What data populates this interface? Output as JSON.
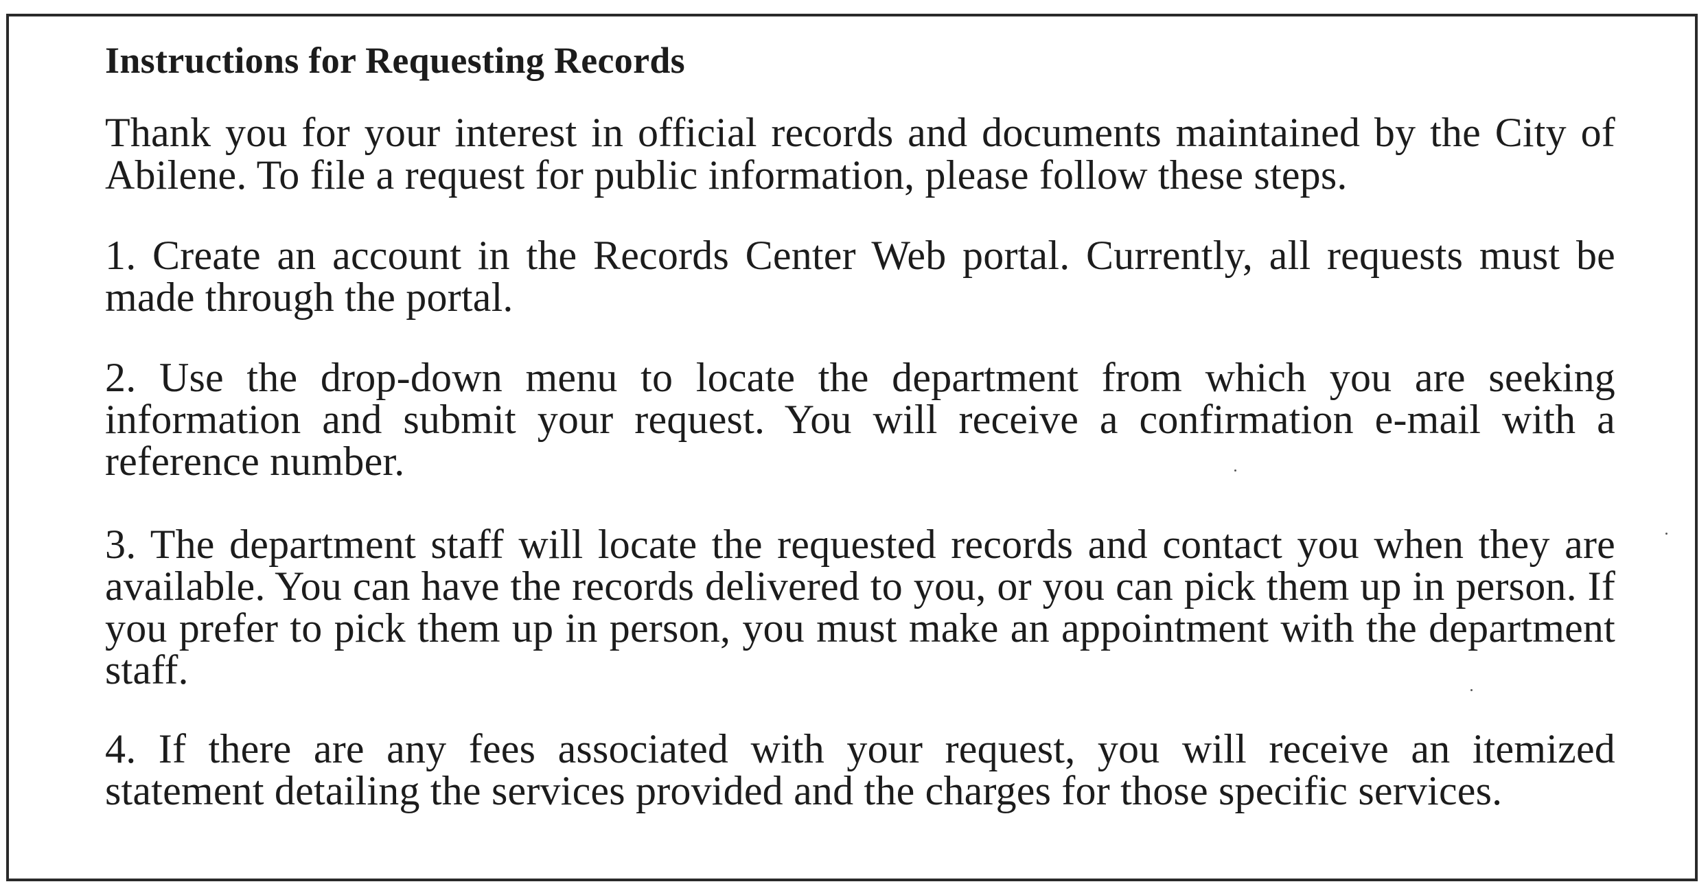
{
  "document": {
    "title": "Instructions for Requesting Records",
    "intro": "Thank you for your interest in official records and documents maintained by the City of Abilene. To file a request for public information, please follow these steps.",
    "steps": [
      "1. Create an account in the Records Center Web portal. Currently, all requests must be made through the portal.",
      "2. Use the drop-down menu to locate the department from which you are seeking information and submit your request. You will receive a confirmation e-mail with a reference number.",
      "3. The department staff will locate the requested records and contact you when they are available. You can have the records delivered to you, or you can pick them up in person. If you prefer to pick them up in person, you must make an appointment with the department staff.",
      "4. If there are any fees associated with your request, you will receive an itemized statement detailing the services provided and the charges for those specific services."
    ]
  }
}
